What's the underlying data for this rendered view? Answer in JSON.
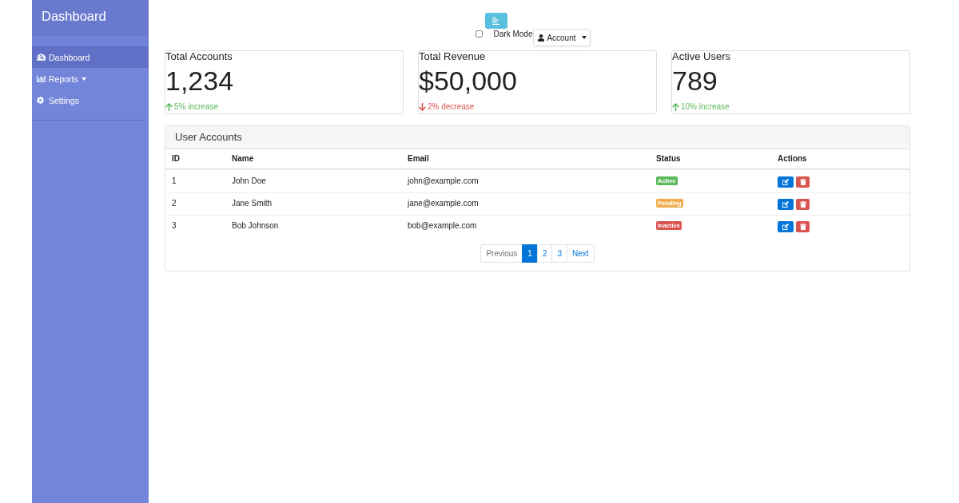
{
  "sidebar": {
    "title": "Dashboard",
    "items": [
      {
        "label": "Dashboard",
        "kind": "link",
        "selected": true
      },
      {
        "label": "Reports",
        "kind": "dropdown",
        "selected": false
      },
      {
        "label": "Settings",
        "kind": "link",
        "selected": false
      }
    ]
  },
  "top_bar": {
    "dark_mode": {
      "label": "Dark Mode",
      "checked": false
    },
    "account": {
      "label": "Account"
    }
  },
  "cards": [
    {
      "title": "Total Accounts",
      "value": "1,234",
      "change": "5% increase",
      "kind": "up"
    },
    {
      "title": "Total Revenue",
      "value": "$50,000",
      "change": "2% decrease",
      "kind": "down"
    },
    {
      "title": "Active Users",
      "value": "789",
      "change": "10% increase",
      "kind": "up"
    }
  ],
  "table": {
    "title": "User Accounts",
    "columns": [
      "ID",
      "Name",
      "Email",
      "Status",
      "Actions"
    ],
    "rows": [
      {
        "id": "1",
        "name": "John Doe",
        "email": "john@example.com",
        "status": {
          "label": "Active",
          "color": "#5cb85c"
        }
      },
      {
        "id": "2",
        "name": "Jane Smith",
        "email": "jane@example.com",
        "status": {
          "label": "Pending",
          "color": "#f0ad4e"
        }
      },
      {
        "id": "3",
        "name": "Bob Johnson",
        "email": "bob@example.com",
        "status": {
          "label": "Inactive",
          "color": "#d9534f"
        }
      }
    ],
    "pagination": [
      {
        "label": "Previous",
        "selected": false,
        "disabled": true
      },
      {
        "label": "1",
        "selected": true,
        "disabled": false
      },
      {
        "label": "2",
        "selected": false,
        "disabled": false
      },
      {
        "label": "3",
        "selected": false,
        "disabled": false
      },
      {
        "label": "Next",
        "selected": false,
        "disabled": false
      }
    ]
  }
}
